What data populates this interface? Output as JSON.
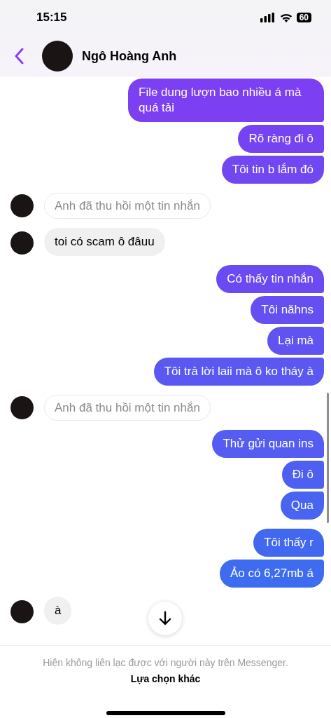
{
  "status_bar": {
    "time": "15:15",
    "battery": "60"
  },
  "header": {
    "name": "Ngô Hoàng Anh"
  },
  "groups": [
    {
      "kind": "sent",
      "items": [
        {
          "kind": "text",
          "text": "File dung lượn bao nhiều á mà quá tải"
        },
        {
          "kind": "text",
          "text": "Rõ ràng đi ô"
        },
        {
          "kind": "text",
          "text": "Tôi tin b lắm đó"
        }
      ]
    },
    {
      "kind": "received",
      "items": [
        {
          "kind": "recalled",
          "text": "Anh đã thu hồi một tin nhắn"
        }
      ]
    },
    {
      "kind": "received",
      "items": [
        {
          "kind": "text",
          "text": "toi có scam ô đâuu"
        }
      ]
    },
    {
      "kind": "sent",
      "items": [
        {
          "kind": "text",
          "text": "Có thấy tin nhắn"
        },
        {
          "kind": "text",
          "text": "Tôi năhns"
        },
        {
          "kind": "text",
          "text": "Lại mà"
        },
        {
          "kind": "text",
          "text": "Tôi trả lời laii mà ô ko tháy à"
        }
      ]
    },
    {
      "kind": "received",
      "items": [
        {
          "kind": "recalled",
          "text": "Anh đã thu hồi một tin nhắn"
        }
      ]
    },
    {
      "kind": "sent",
      "items": [
        {
          "kind": "text",
          "text": "Thử gửi quan ins"
        },
        {
          "kind": "text",
          "text": "Đi ô"
        },
        {
          "kind": "text",
          "text": "Qua"
        }
      ]
    },
    {
      "kind": "sent",
      "items": [
        {
          "kind": "text",
          "text": "Tôi thấy r"
        },
        {
          "kind": "text",
          "text": "Ảo có 6,27mb á"
        }
      ]
    },
    {
      "kind": "received",
      "items": [
        {
          "kind": "text",
          "text": "à"
        }
      ]
    }
  ],
  "footer": {
    "notice": "Hiện không liên lạc được với người này trên Messenger.",
    "link": "Lựa chọn khác"
  }
}
